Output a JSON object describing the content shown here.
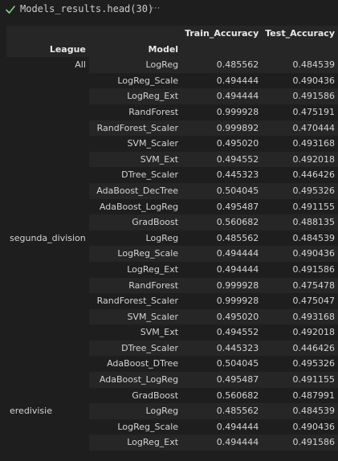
{
  "cell": {
    "code": "Models_results.head(30)",
    "status_icon": "check-icon",
    "more_icon": "ellipsis-icon"
  },
  "table": {
    "columns": [
      "Train_Accuracy",
      "Test_Accuracy"
    ],
    "index_names": [
      "League",
      "Model"
    ],
    "groups": [
      {
        "league": "All",
        "rows": [
          {
            "model": "LogReg",
            "train": "0.485562",
            "test": "0.484539"
          },
          {
            "model": "LogReg_Scale",
            "train": "0.494444",
            "test": "0.490436"
          },
          {
            "model": "LogReg_Ext",
            "train": "0.494444",
            "test": "0.491586"
          },
          {
            "model": "RandForest",
            "train": "0.999928",
            "test": "0.475191"
          },
          {
            "model": "RandForest_Scaler",
            "train": "0.999892",
            "test": "0.470444"
          },
          {
            "model": "SVM_Scaler",
            "train": "0.495020",
            "test": "0.493168"
          },
          {
            "model": "SVM_Ext",
            "train": "0.494552",
            "test": "0.492018"
          },
          {
            "model": "DTree_Scaler",
            "train": "0.445323",
            "test": "0.446426"
          },
          {
            "model": "AdaBoost_DecTree",
            "train": "0.504045",
            "test": "0.495326"
          },
          {
            "model": "AdaBoost_LogReg",
            "train": "0.495487",
            "test": "0.491155"
          },
          {
            "model": "GradBoost",
            "train": "0.560682",
            "test": "0.488135"
          }
        ]
      },
      {
        "league": "segunda_division",
        "rows": [
          {
            "model": "LogReg",
            "train": "0.485562",
            "test": "0.484539"
          },
          {
            "model": "LogReg_Scale",
            "train": "0.494444",
            "test": "0.490436"
          },
          {
            "model": "LogReg_Ext",
            "train": "0.494444",
            "test": "0.491586"
          },
          {
            "model": "RandForest",
            "train": "0.999928",
            "test": "0.475478"
          },
          {
            "model": "RandForest_Scaler",
            "train": "0.999928",
            "test": "0.475047"
          },
          {
            "model": "SVM_Scaler",
            "train": "0.495020",
            "test": "0.493168"
          },
          {
            "model": "SVM_Ext",
            "train": "0.494552",
            "test": "0.492018"
          },
          {
            "model": "DTree_Scaler",
            "train": "0.445323",
            "test": "0.446426"
          },
          {
            "model": "AdaBoost_DTree",
            "train": "0.504045",
            "test": "0.495326"
          },
          {
            "model": "AdaBoost_LogReg",
            "train": "0.495487",
            "test": "0.491155"
          },
          {
            "model": "GradBoost",
            "train": "0.560682",
            "test": "0.487991"
          }
        ]
      },
      {
        "league": "eredivisie",
        "rows": [
          {
            "model": "LogReg",
            "train": "0.485562",
            "test": "0.484539"
          },
          {
            "model": "LogReg_Scale",
            "train": "0.494444",
            "test": "0.490436"
          },
          {
            "model": "LogReg_Ext",
            "train": "0.494444",
            "test": "0.491586"
          }
        ]
      }
    ]
  },
  "colors": {
    "background": "#1e1e1e",
    "stripe": "#262626",
    "success_green": "#89d185",
    "text": "#d4d4d4"
  }
}
